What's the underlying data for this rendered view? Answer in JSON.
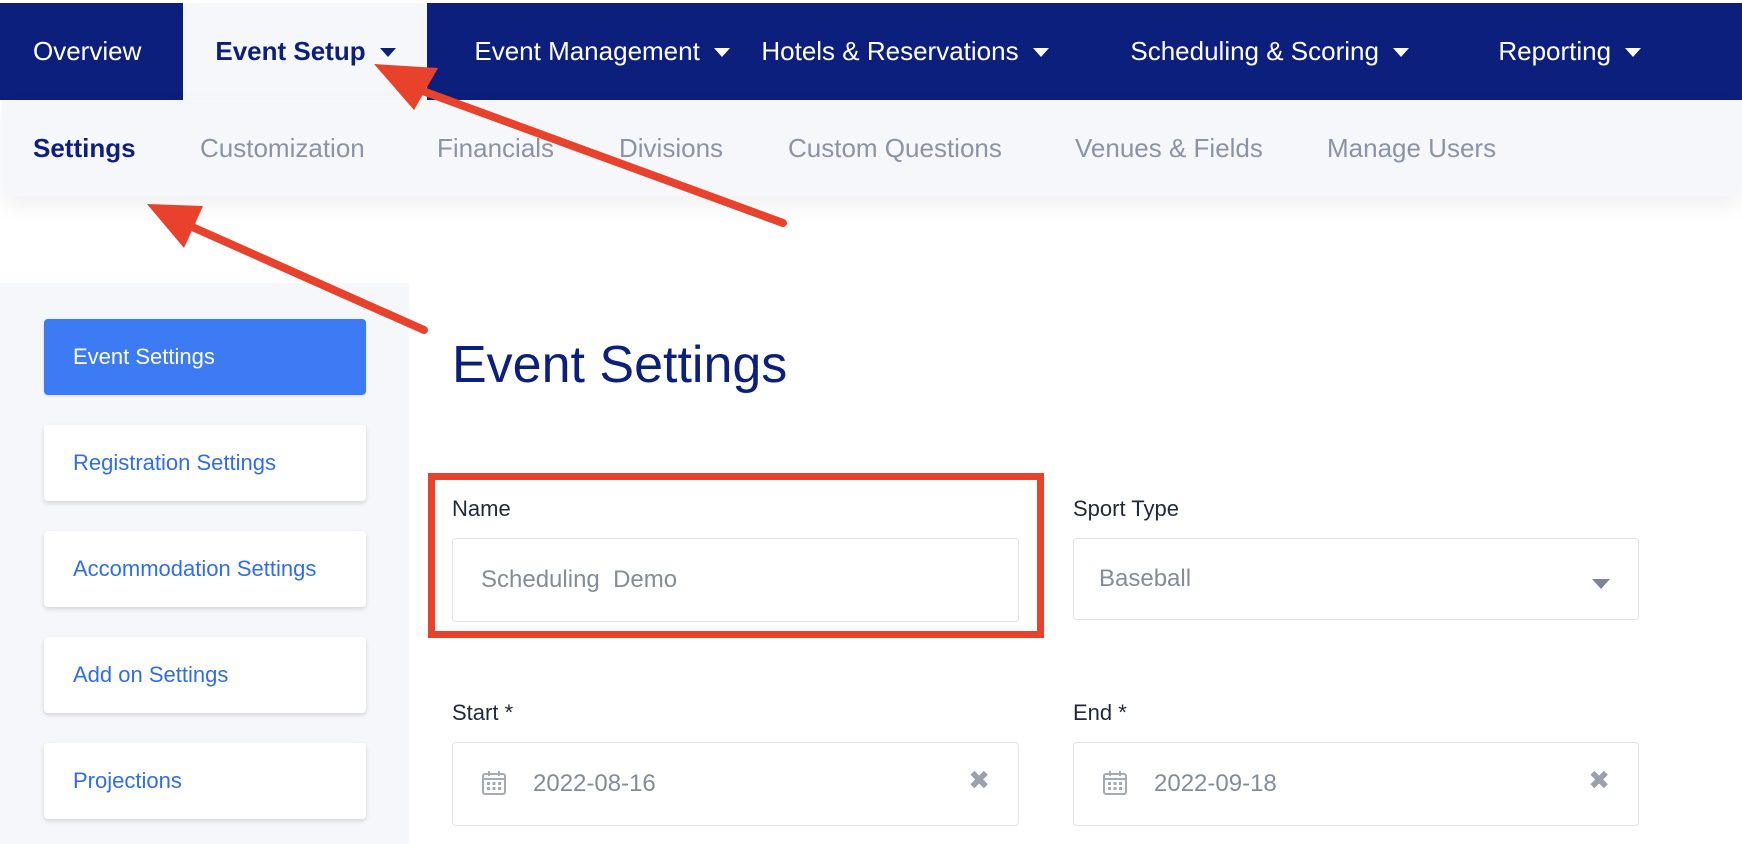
{
  "topnav": {
    "tabs": [
      {
        "label": "Overview",
        "active": false,
        "dropdown": false
      },
      {
        "label": "Event Setup",
        "active": true,
        "dropdown": true
      },
      {
        "label": "Event Management",
        "active": false,
        "dropdown": true
      },
      {
        "label": "Hotels & Reservations",
        "active": false,
        "dropdown": true
      },
      {
        "label": "Scheduling & Scoring",
        "active": false,
        "dropdown": true
      },
      {
        "label": "Reporting",
        "active": false,
        "dropdown": true
      }
    ]
  },
  "subnav": {
    "tabs": [
      {
        "label": "Settings",
        "active": true
      },
      {
        "label": "Customization",
        "active": false
      },
      {
        "label": "Financials",
        "active": false
      },
      {
        "label": "Divisions",
        "active": false
      },
      {
        "label": "Custom Questions",
        "active": false
      },
      {
        "label": "Venues & Fields",
        "active": false
      },
      {
        "label": "Manage Users",
        "active": false
      }
    ]
  },
  "sidebar": {
    "items": [
      {
        "label": "Event Settings",
        "active": true
      },
      {
        "label": "Registration Settings",
        "active": false
      },
      {
        "label": "Accommodation Settings",
        "active": false
      },
      {
        "label": "Add on Settings",
        "active": false
      },
      {
        "label": "Projections",
        "active": false
      }
    ]
  },
  "main": {
    "title": "Event Settings",
    "name": {
      "label": "Name",
      "value": "Scheduling  Demo"
    },
    "sport_type": {
      "label": "Sport Type",
      "value": "Baseball"
    },
    "start": {
      "label": "Start *",
      "value": "2022-08-16"
    },
    "end": {
      "label": "End *",
      "value": "2022-09-18"
    }
  },
  "colors": {
    "nav_bg": "#0c1f7c",
    "accent_blue": "#3d7bf5",
    "annotation_red": "#e8412c",
    "subnav_bg": "#f6f7fb"
  },
  "icons": [
    "caret-down-icon",
    "chevron-down-icon",
    "calendar-icon",
    "clear-icon"
  ]
}
